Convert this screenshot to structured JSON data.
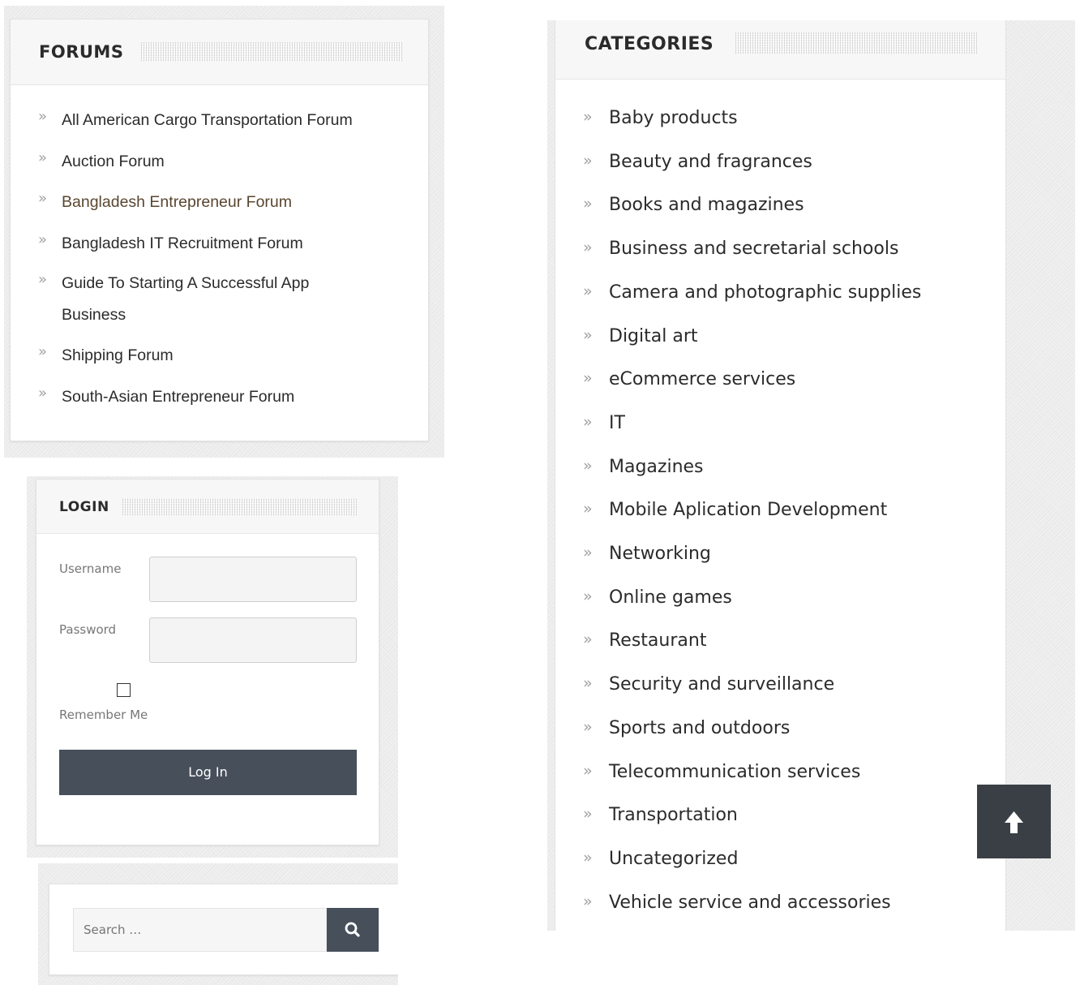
{
  "forums": {
    "title": "FORUMS",
    "items": [
      {
        "label": "All American Cargo Transportation Forum"
      },
      {
        "label": "Auction Forum"
      },
      {
        "label": "Bangladesh Entrepreneur Forum"
      },
      {
        "label": "Bangladesh IT Recruitment Forum"
      },
      {
        "label": "Guide To Starting A Successful App Business"
      },
      {
        "label": "Shipping Forum"
      },
      {
        "label": "South-Asian Entrepreneur Forum"
      }
    ]
  },
  "login": {
    "title": "LOGIN",
    "username_label": "Username",
    "password_label": "Password",
    "remember_label": "Remember Me",
    "submit_label": "Log In"
  },
  "search": {
    "placeholder": "Search …",
    "icon": "search-icon"
  },
  "categories": {
    "title": "CATEGORIES",
    "items": [
      {
        "label": "Baby products"
      },
      {
        "label": "Beauty and fragrances"
      },
      {
        "label": "Books and magazines"
      },
      {
        "label": "Business and secretarial schools"
      },
      {
        "label": "Camera and photographic supplies"
      },
      {
        "label": "Digital art"
      },
      {
        "label": "eCommerce services"
      },
      {
        "label": "IT"
      },
      {
        "label": "Magazines"
      },
      {
        "label": "Mobile Aplication Development"
      },
      {
        "label": "Networking"
      },
      {
        "label": "Online games"
      },
      {
        "label": "Restaurant"
      },
      {
        "label": "Security and surveillance"
      },
      {
        "label": "Sports and outdoors"
      },
      {
        "label": "Telecommunication services"
      },
      {
        "label": "Transportation"
      },
      {
        "label": "Uncategorized"
      },
      {
        "label": "Vehicle service and accessories"
      }
    ]
  },
  "scroll_top": {
    "icon": "arrow-up-icon"
  },
  "colors": {
    "dark_button": "#474f5b",
    "scroll_top_bg": "#3a3f45",
    "link_text": "#333333",
    "chevron": "#a0a0a0"
  }
}
